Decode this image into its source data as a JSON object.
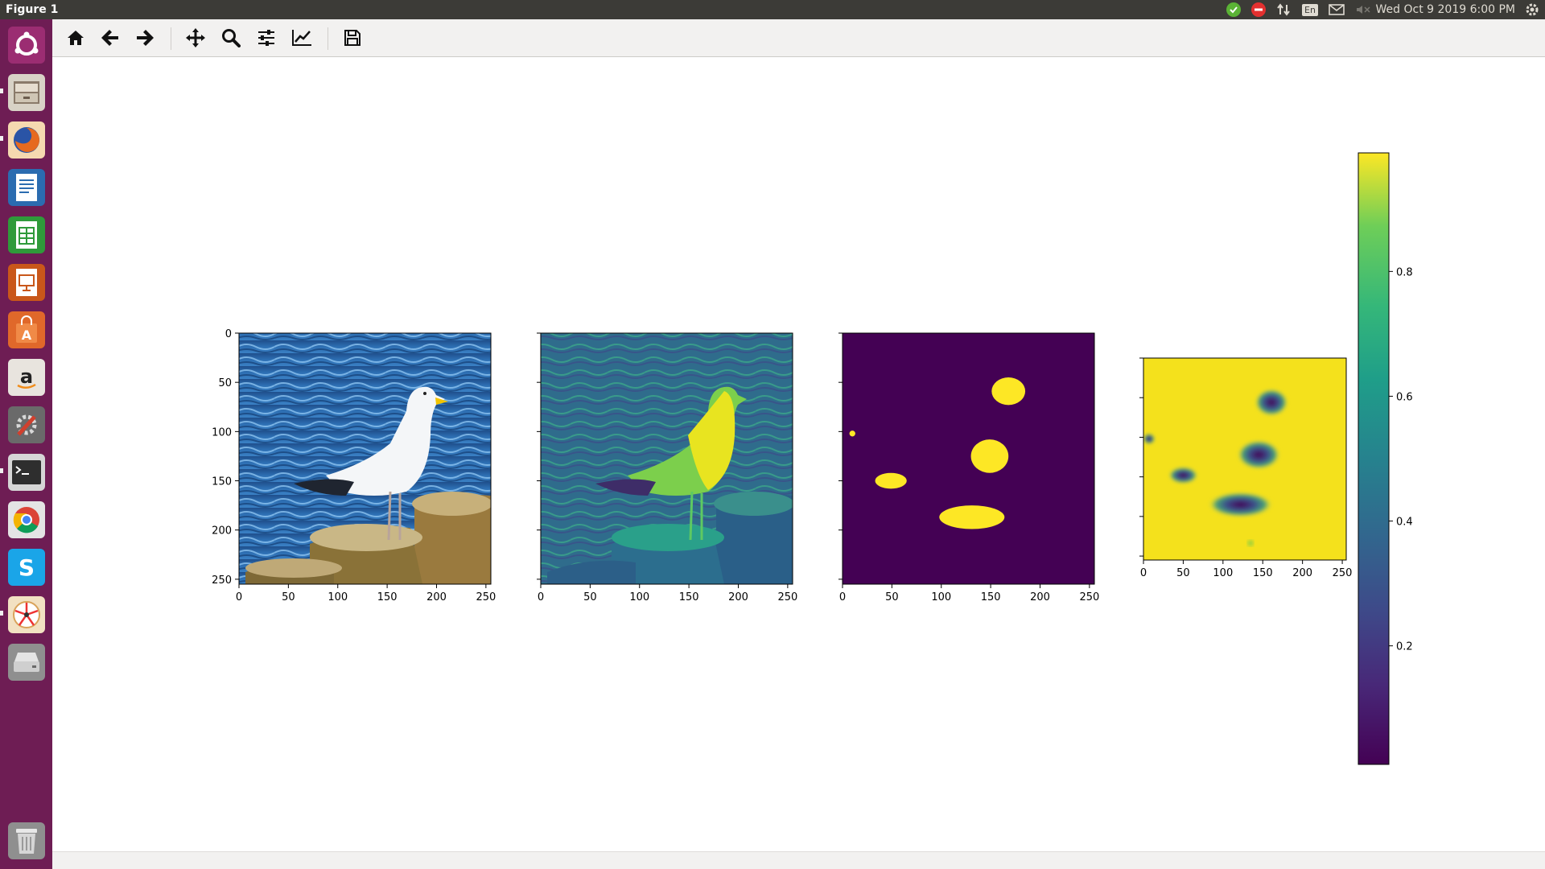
{
  "window": {
    "title": "Figure 1"
  },
  "panel": {
    "clock": "Wed Oct  9 2019  6:00 PM",
    "keyboard": "En"
  },
  "launcher": {
    "items": [
      {
        "name": "dash",
        "color": "#9b2d72"
      },
      {
        "name": "files",
        "color": "#8a6a55"
      },
      {
        "name": "firefox",
        "color": "#e5731f"
      },
      {
        "name": "writer",
        "color": "#2b6cb0"
      },
      {
        "name": "calc",
        "color": "#2f9a3a"
      },
      {
        "name": "impress",
        "color": "#c9571a"
      },
      {
        "name": "software-center",
        "color": "#e0682a"
      },
      {
        "name": "amazon",
        "color": "#e8e4de"
      },
      {
        "name": "settings",
        "color": "#d0402e"
      },
      {
        "name": "terminal",
        "color": "#2e2e2e"
      },
      {
        "name": "chrome",
        "color": "#4285f4"
      },
      {
        "name": "skype",
        "color": "#1aa5e8"
      },
      {
        "name": "app",
        "color": "#f2e1c2"
      },
      {
        "name": "drive",
        "color": "#b9b9b9"
      },
      {
        "name": "trash",
        "color": "#8f8f8f"
      }
    ]
  },
  "toolbar": {
    "buttons": [
      "home-icon",
      "back-arrow-icon",
      "forward-arrow-icon",
      "pan-icon",
      "zoom-icon",
      "configure-subplots-icon",
      "edit-axes-icon",
      "save-icon"
    ]
  },
  "chart_data": [
    {
      "type": "heatmap",
      "xticks": [
        0,
        50,
        100,
        150,
        200,
        250
      ],
      "yticks": [
        0,
        50,
        100,
        150,
        200,
        250
      ],
      "xlim": [
        0,
        255
      ],
      "ylim": [
        255,
        0
      ]
    },
    {
      "type": "heatmap",
      "xticks": [
        0,
        50,
        100,
        150,
        200,
        250
      ],
      "xlim": [
        0,
        255
      ],
      "ylim": [
        255,
        0
      ]
    },
    {
      "type": "heatmap",
      "xticks": [
        0,
        50,
        100,
        150,
        200,
        250
      ],
      "xlim": [
        0,
        255
      ],
      "ylim": [
        255,
        0
      ],
      "blobs": [
        {
          "cx": 10,
          "cy": 102,
          "rx": 3,
          "ry": 3
        },
        {
          "cx": 168,
          "cy": 59,
          "rx": 17,
          "ry": 14
        },
        {
          "cx": 149,
          "cy": 125,
          "rx": 19,
          "ry": 17
        },
        {
          "cx": 49,
          "cy": 150,
          "rx": 16,
          "ry": 8
        },
        {
          "cx": 131,
          "cy": 187,
          "rx": 33,
          "ry": 12
        }
      ]
    },
    {
      "type": "heatmap",
      "xticks": [
        0,
        50,
        100,
        150,
        200,
        250
      ],
      "xlim": [
        0,
        255
      ],
      "ylim": [
        255,
        0
      ],
      "low_regions": [
        {
          "cx": 161,
          "cy": 56,
          "rx": 17,
          "ry": 13
        },
        {
          "cx": 145,
          "cy": 122,
          "rx": 22,
          "ry": 14
        },
        {
          "cx": 50,
          "cy": 148,
          "rx": 15,
          "ry": 8
        },
        {
          "cx": 122,
          "cy": 185,
          "rx": 33,
          "ry": 12
        },
        {
          "cx": 7,
          "cy": 102,
          "rx": 6,
          "ry": 5
        }
      ]
    },
    {
      "type": "colorbar",
      "colormap": "viridis",
      "range": [
        0.01,
        0.99
      ],
      "ticks": [
        0.2,
        0.4,
        0.6,
        0.8
      ],
      "tick_labels": [
        "0.2",
        "0.4",
        "0.6",
        "0.8"
      ]
    }
  ]
}
